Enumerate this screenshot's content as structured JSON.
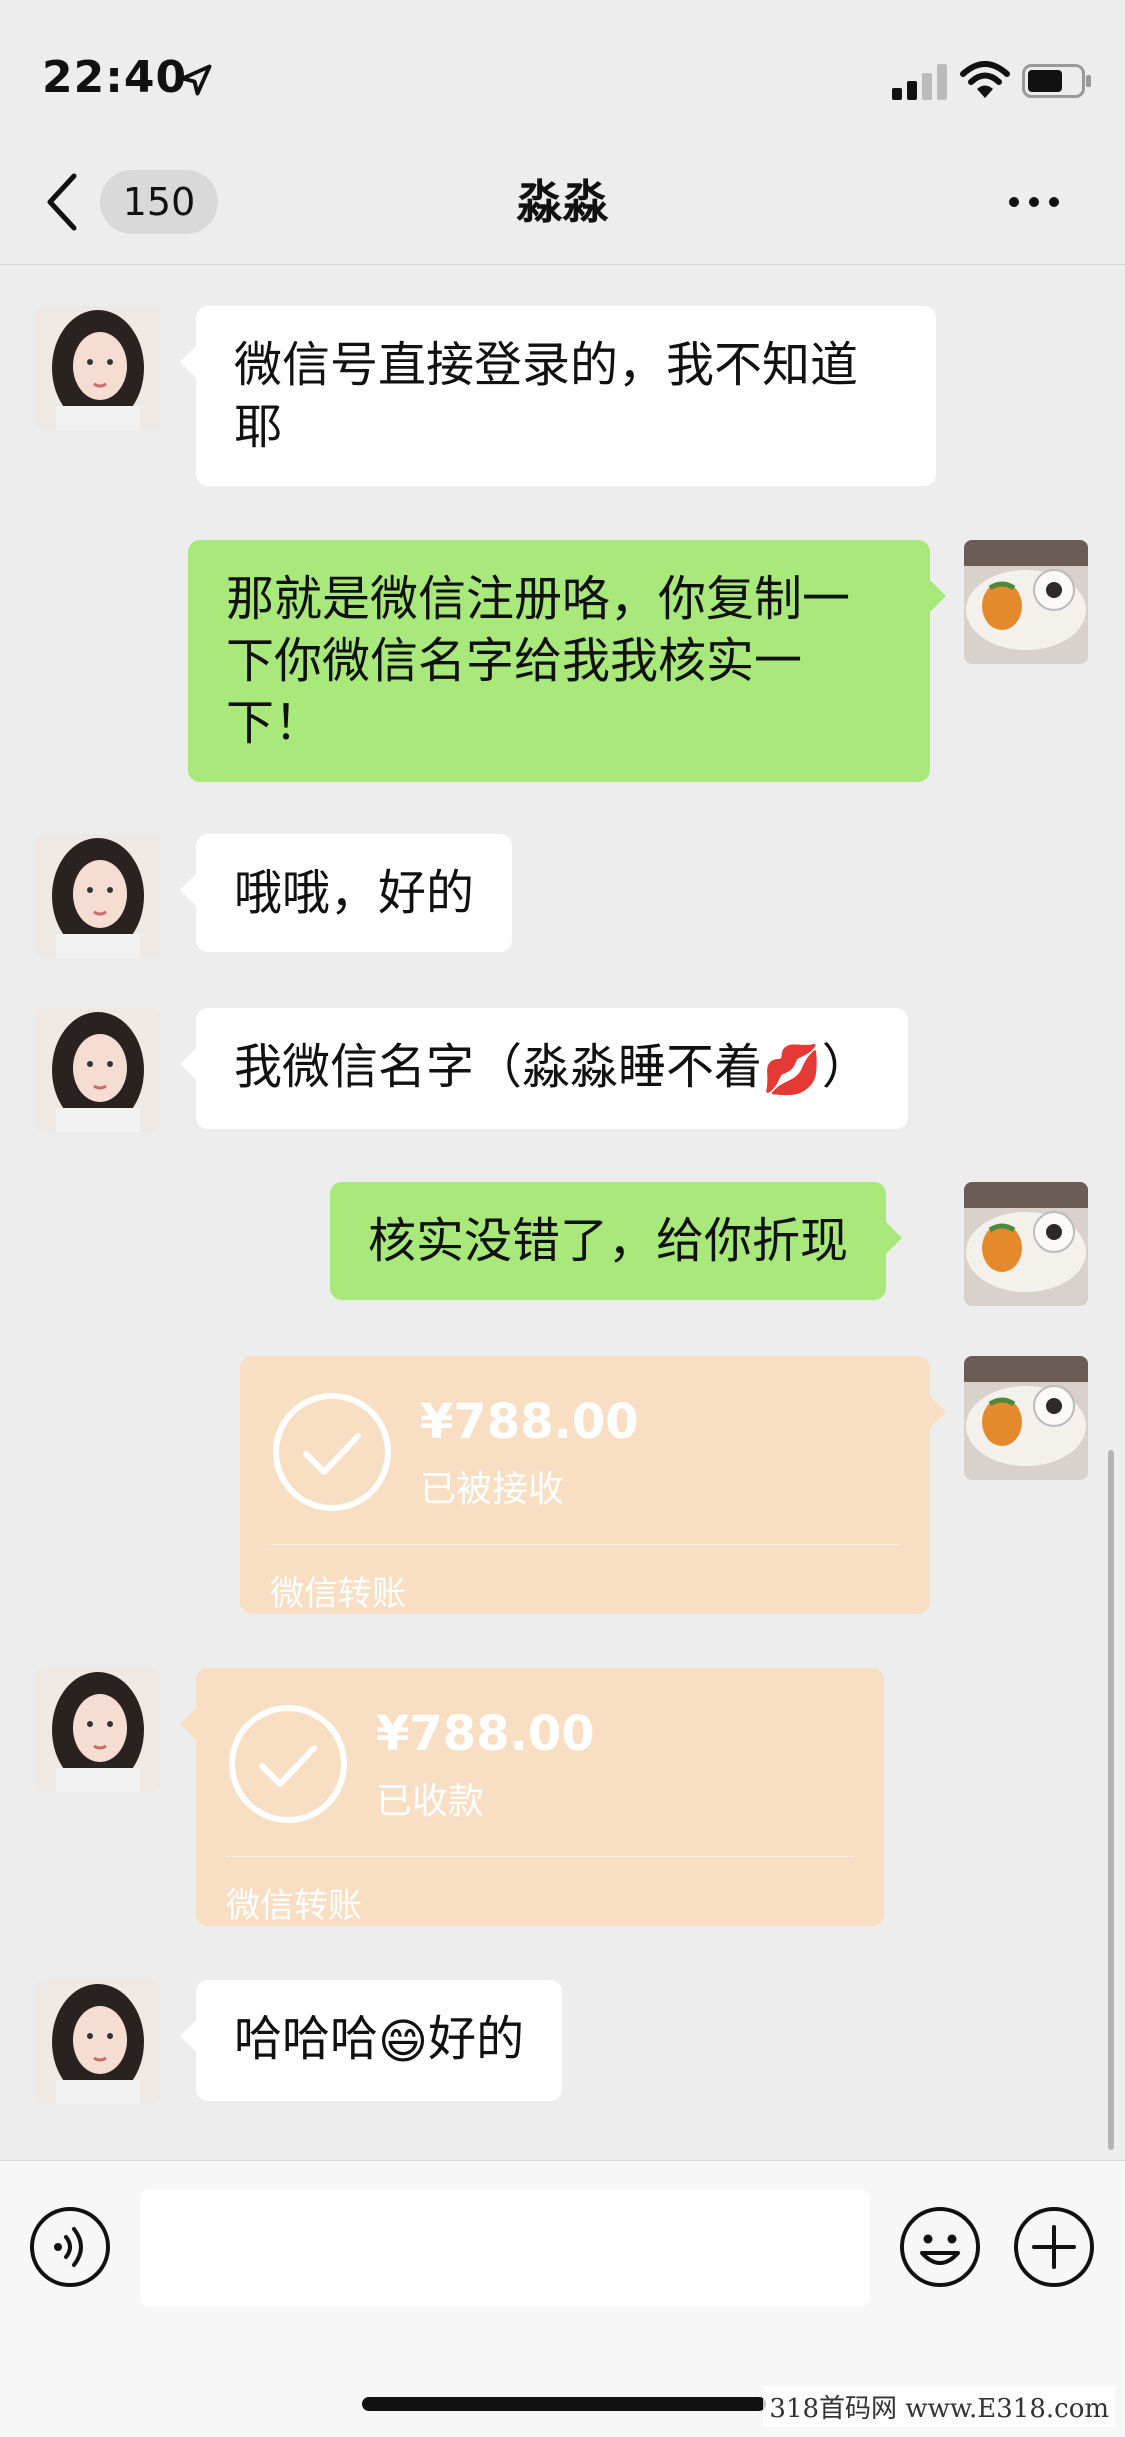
{
  "status_bar": {
    "time": "22:40"
  },
  "nav": {
    "unread_count": "150",
    "title": "淼淼"
  },
  "messages": [
    {
      "sender": "contact",
      "text": "微信号直接登录的，我不知道耶"
    },
    {
      "sender": "me",
      "text": "那就是微信注册咯，你复制一下你微信名字给我我核实一下！"
    },
    {
      "sender": "contact",
      "text": "哦哦，好的"
    },
    {
      "sender": "contact",
      "text": "我微信名字（淼淼睡不着",
      "emoji": "💋",
      "text_after": "）"
    },
    {
      "sender": "me",
      "text": "核实没错了，给你折现"
    },
    {
      "sender": "me",
      "type": "transfer",
      "amount": "¥788.00",
      "status": "已被接收",
      "footer": "微信转账"
    },
    {
      "sender": "contact",
      "type": "transfer",
      "amount": "¥788.00",
      "status": "已收款",
      "footer": "微信转账"
    },
    {
      "sender": "contact",
      "text": "哈哈哈",
      "emoji": "😄",
      "text_after": "好的"
    }
  ],
  "watermark": "318首码网  www.E318.com",
  "colors": {
    "background": "#ededed",
    "my_bubble": "#a9e97b",
    "their_bubble": "#ffffff",
    "transfer": "#f8dfc3"
  },
  "icons": [
    "location-arrow-icon",
    "signal-icon",
    "wifi-icon",
    "battery-icon",
    "back-chevron-icon",
    "more-icon",
    "voice-icon",
    "emoji-icon",
    "plus-icon",
    "check-icon"
  ]
}
